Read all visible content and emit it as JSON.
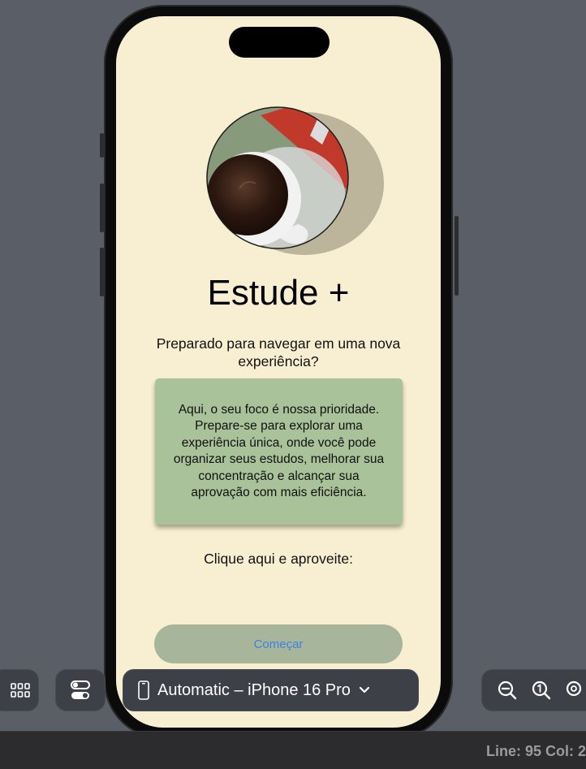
{
  "device_preview": {
    "title": "Estude +",
    "subtitle": "Preparado para navegar em uma nova experiência?",
    "card_text": "Aqui, o seu foco é nossa prioridade. Prepare-se para explorar uma experiência única, onde você pode organizar seus estudos, melhorar sua concentração e alcançar sua aprovação com mais eficiência.",
    "cta_label": "Clique aqui e aproveite:",
    "start_button": "Começar",
    "colors": {
      "screen_bg": "#f8efd2",
      "card_bg": "#a9c29a",
      "button_bg": "#a7b69a",
      "button_text": "#3b82e0"
    }
  },
  "toolbar": {
    "device_picker": "Automatic – iPhone 16 Pro",
    "icons": [
      "grid-icon",
      "toggle-variants-icon",
      "phone-icon",
      "chevron-down-icon",
      "zoom-out-icon",
      "zoom-actual-icon",
      "zoom-fit-icon"
    ]
  },
  "status": {
    "position": "Line: 95  Col: 2"
  }
}
